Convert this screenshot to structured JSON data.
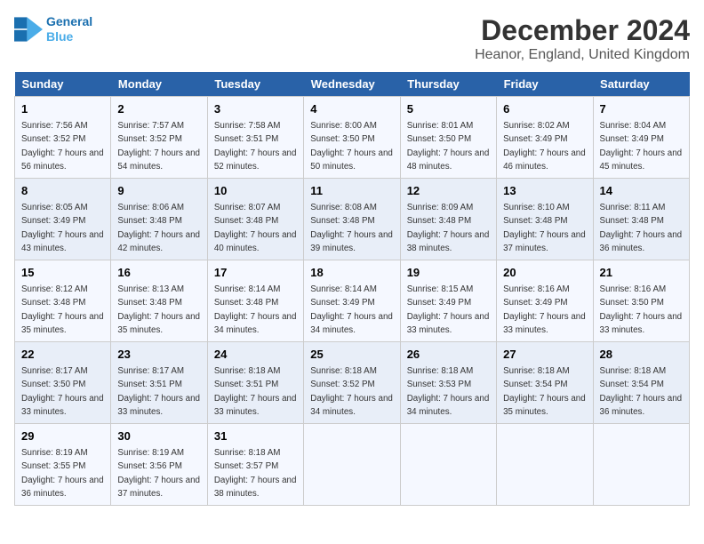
{
  "logo": {
    "line1": "General",
    "line2": "Blue"
  },
  "title": "December 2024",
  "location": "Heanor, England, United Kingdom",
  "header_colors": {
    "bg": "#2962a8",
    "text": "#ffffff"
  },
  "days_of_week": [
    "Sunday",
    "Monday",
    "Tuesday",
    "Wednesday",
    "Thursday",
    "Friday",
    "Saturday"
  ],
  "weeks": [
    [
      {
        "day": "1",
        "sunrise": "Sunrise: 7:56 AM",
        "sunset": "Sunset: 3:52 PM",
        "daylight": "Daylight: 7 hours and 56 minutes."
      },
      {
        "day": "2",
        "sunrise": "Sunrise: 7:57 AM",
        "sunset": "Sunset: 3:52 PM",
        "daylight": "Daylight: 7 hours and 54 minutes."
      },
      {
        "day": "3",
        "sunrise": "Sunrise: 7:58 AM",
        "sunset": "Sunset: 3:51 PM",
        "daylight": "Daylight: 7 hours and 52 minutes."
      },
      {
        "day": "4",
        "sunrise": "Sunrise: 8:00 AM",
        "sunset": "Sunset: 3:50 PM",
        "daylight": "Daylight: 7 hours and 50 minutes."
      },
      {
        "day": "5",
        "sunrise": "Sunrise: 8:01 AM",
        "sunset": "Sunset: 3:50 PM",
        "daylight": "Daylight: 7 hours and 48 minutes."
      },
      {
        "day": "6",
        "sunrise": "Sunrise: 8:02 AM",
        "sunset": "Sunset: 3:49 PM",
        "daylight": "Daylight: 7 hours and 46 minutes."
      },
      {
        "day": "7",
        "sunrise": "Sunrise: 8:04 AM",
        "sunset": "Sunset: 3:49 PM",
        "daylight": "Daylight: 7 hours and 45 minutes."
      }
    ],
    [
      {
        "day": "8",
        "sunrise": "Sunrise: 8:05 AM",
        "sunset": "Sunset: 3:49 PM",
        "daylight": "Daylight: 7 hours and 43 minutes."
      },
      {
        "day": "9",
        "sunrise": "Sunrise: 8:06 AM",
        "sunset": "Sunset: 3:48 PM",
        "daylight": "Daylight: 7 hours and 42 minutes."
      },
      {
        "day": "10",
        "sunrise": "Sunrise: 8:07 AM",
        "sunset": "Sunset: 3:48 PM",
        "daylight": "Daylight: 7 hours and 40 minutes."
      },
      {
        "day": "11",
        "sunrise": "Sunrise: 8:08 AM",
        "sunset": "Sunset: 3:48 PM",
        "daylight": "Daylight: 7 hours and 39 minutes."
      },
      {
        "day": "12",
        "sunrise": "Sunrise: 8:09 AM",
        "sunset": "Sunset: 3:48 PM",
        "daylight": "Daylight: 7 hours and 38 minutes."
      },
      {
        "day": "13",
        "sunrise": "Sunrise: 8:10 AM",
        "sunset": "Sunset: 3:48 PM",
        "daylight": "Daylight: 7 hours and 37 minutes."
      },
      {
        "day": "14",
        "sunrise": "Sunrise: 8:11 AM",
        "sunset": "Sunset: 3:48 PM",
        "daylight": "Daylight: 7 hours and 36 minutes."
      }
    ],
    [
      {
        "day": "15",
        "sunrise": "Sunrise: 8:12 AM",
        "sunset": "Sunset: 3:48 PM",
        "daylight": "Daylight: 7 hours and 35 minutes."
      },
      {
        "day": "16",
        "sunrise": "Sunrise: 8:13 AM",
        "sunset": "Sunset: 3:48 PM",
        "daylight": "Daylight: 7 hours and 35 minutes."
      },
      {
        "day": "17",
        "sunrise": "Sunrise: 8:14 AM",
        "sunset": "Sunset: 3:48 PM",
        "daylight": "Daylight: 7 hours and 34 minutes."
      },
      {
        "day": "18",
        "sunrise": "Sunrise: 8:14 AM",
        "sunset": "Sunset: 3:49 PM",
        "daylight": "Daylight: 7 hours and 34 minutes."
      },
      {
        "day": "19",
        "sunrise": "Sunrise: 8:15 AM",
        "sunset": "Sunset: 3:49 PM",
        "daylight": "Daylight: 7 hours and 33 minutes."
      },
      {
        "day": "20",
        "sunrise": "Sunrise: 8:16 AM",
        "sunset": "Sunset: 3:49 PM",
        "daylight": "Daylight: 7 hours and 33 minutes."
      },
      {
        "day": "21",
        "sunrise": "Sunrise: 8:16 AM",
        "sunset": "Sunset: 3:50 PM",
        "daylight": "Daylight: 7 hours and 33 minutes."
      }
    ],
    [
      {
        "day": "22",
        "sunrise": "Sunrise: 8:17 AM",
        "sunset": "Sunset: 3:50 PM",
        "daylight": "Daylight: 7 hours and 33 minutes."
      },
      {
        "day": "23",
        "sunrise": "Sunrise: 8:17 AM",
        "sunset": "Sunset: 3:51 PM",
        "daylight": "Daylight: 7 hours and 33 minutes."
      },
      {
        "day": "24",
        "sunrise": "Sunrise: 8:18 AM",
        "sunset": "Sunset: 3:51 PM",
        "daylight": "Daylight: 7 hours and 33 minutes."
      },
      {
        "day": "25",
        "sunrise": "Sunrise: 8:18 AM",
        "sunset": "Sunset: 3:52 PM",
        "daylight": "Daylight: 7 hours and 34 minutes."
      },
      {
        "day": "26",
        "sunrise": "Sunrise: 8:18 AM",
        "sunset": "Sunset: 3:53 PM",
        "daylight": "Daylight: 7 hours and 34 minutes."
      },
      {
        "day": "27",
        "sunrise": "Sunrise: 8:18 AM",
        "sunset": "Sunset: 3:54 PM",
        "daylight": "Daylight: 7 hours and 35 minutes."
      },
      {
        "day": "28",
        "sunrise": "Sunrise: 8:18 AM",
        "sunset": "Sunset: 3:54 PM",
        "daylight": "Daylight: 7 hours and 36 minutes."
      }
    ],
    [
      {
        "day": "29",
        "sunrise": "Sunrise: 8:19 AM",
        "sunset": "Sunset: 3:55 PM",
        "daylight": "Daylight: 7 hours and 36 minutes."
      },
      {
        "day": "30",
        "sunrise": "Sunrise: 8:19 AM",
        "sunset": "Sunset: 3:56 PM",
        "daylight": "Daylight: 7 hours and 37 minutes."
      },
      {
        "day": "31",
        "sunrise": "Sunrise: 8:18 AM",
        "sunset": "Sunset: 3:57 PM",
        "daylight": "Daylight: 7 hours and 38 minutes."
      },
      null,
      null,
      null,
      null
    ]
  ]
}
